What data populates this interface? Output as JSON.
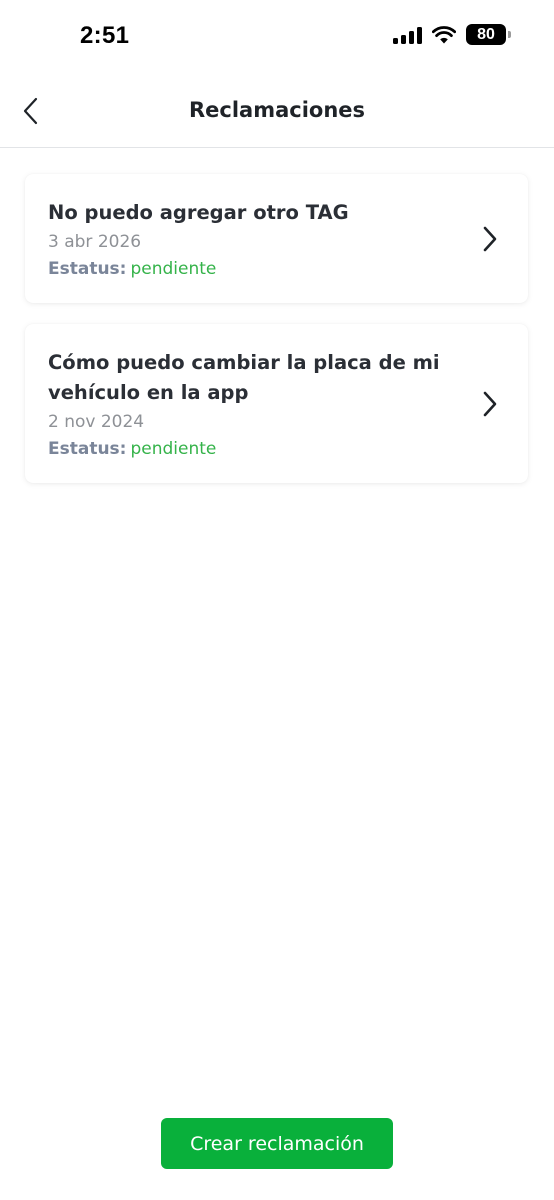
{
  "status_bar": {
    "time": "2:51",
    "battery_level": "80",
    "icons": [
      "signal-icon",
      "wifi-icon",
      "battery-icon"
    ]
  },
  "header": {
    "title": "Reclamaciones",
    "back_icon": "chevron-left-icon"
  },
  "claims": [
    {
      "title": "No puedo agregar otro TAG",
      "date": "3 abr 2026",
      "status_label": "Estatus:",
      "status_value": "pendiente"
    },
    {
      "title": "Cómo puedo cambiar la placa de mi vehículo en la app",
      "date": "2 nov 2024",
      "status_label": "Estatus:",
      "status_value": "pendiente"
    }
  ],
  "actions": {
    "create_label": "Crear reclamación"
  },
  "colors": {
    "primary": "#09b03b",
    "status_pending": "#35b34a",
    "status_label": "#7a8599",
    "text_dark": "#2b2f36",
    "text_muted": "#8e9196"
  }
}
